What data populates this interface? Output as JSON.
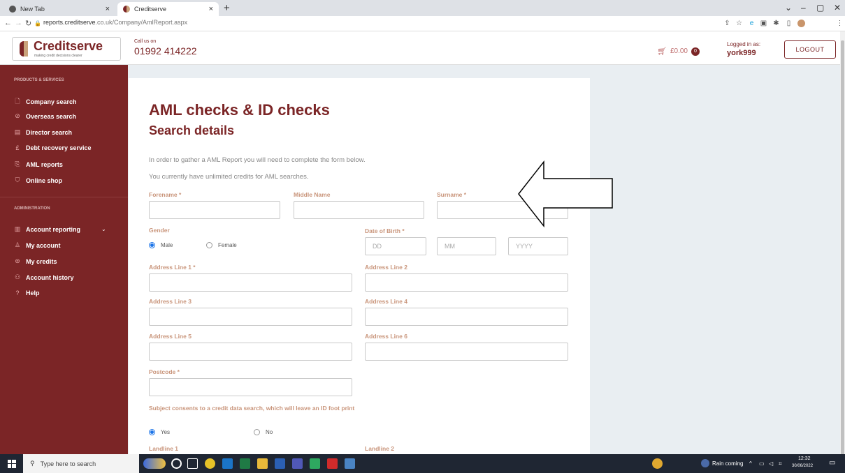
{
  "browser": {
    "tabs": [
      {
        "title": "New Tab",
        "active": false
      },
      {
        "title": "Creditserve",
        "active": true
      }
    ],
    "new_tab_symbol": "+",
    "close_symbol": "×",
    "url_host": "reports.creditserve",
    "url_rest": ".co.uk/Company/AmlReport.aspx",
    "window_controls": [
      "⌄",
      "–",
      "▢",
      "✕"
    ]
  },
  "header": {
    "logo_text": "Creditserve",
    "logo_tagline": "making credit decisions clearer",
    "call_label": "Call us on",
    "phone": "01992 414222",
    "cart_amount": "£0.00",
    "cart_count": "0",
    "logged_label": "Logged in as:",
    "username": "york999",
    "logout_label": "LOGOUT"
  },
  "sidebar": {
    "section1": "PRODUCTS & SERVICES",
    "products": [
      {
        "label": "Company search",
        "icon": "document-search-icon"
      },
      {
        "label": "Overseas search",
        "icon": "globe-icon"
      },
      {
        "label": "Director search",
        "icon": "id-card-icon"
      },
      {
        "label": "Debt recovery service",
        "icon": "pound-icon"
      },
      {
        "label": "AML reports",
        "icon": "report-icon"
      },
      {
        "label": "Online shop",
        "icon": "cart-icon"
      }
    ],
    "section2": "ADMINISTRATION",
    "admin": [
      {
        "label": "Account reporting",
        "icon": "chart-icon"
      },
      {
        "label": "My account",
        "icon": "user-icon"
      },
      {
        "label": "My credits",
        "icon": "credits-icon"
      },
      {
        "label": "Account history",
        "icon": "history-icon"
      },
      {
        "label": "Help",
        "icon": "help-icon"
      }
    ]
  },
  "form": {
    "title": "AML checks & ID checks",
    "subtitle": "Search details",
    "intro": "In order to gather a AML Report you will need to complete the form below.",
    "credits": "You currently have unlimited credits for AML searches.",
    "forename": "Forename *",
    "middle": "Middle Name",
    "surname": "Surname *",
    "gender": "Gender",
    "male": "Male",
    "female": "Female",
    "dob": "Date of Birth *",
    "dd": "DD",
    "mm": "MM",
    "yyyy": "YYYY",
    "addr1": "Address Line 1 *",
    "addr2": "Address Line 2",
    "addr3": "Address Line 3",
    "addr4": "Address Line 4",
    "addr5": "Address Line 5",
    "addr6": "Address Line 6",
    "postcode": "Postcode *",
    "consent": "Subject consents to a credit data search, which will leave an ID foot print",
    "yes": "Yes",
    "no": "No",
    "landline1": "Landline 1",
    "landline2": "Landline 2"
  },
  "taskbar": {
    "search_placeholder": "Type here to search",
    "weather": "Rain coming",
    "time": "12:32",
    "date": "30/06/2022"
  }
}
